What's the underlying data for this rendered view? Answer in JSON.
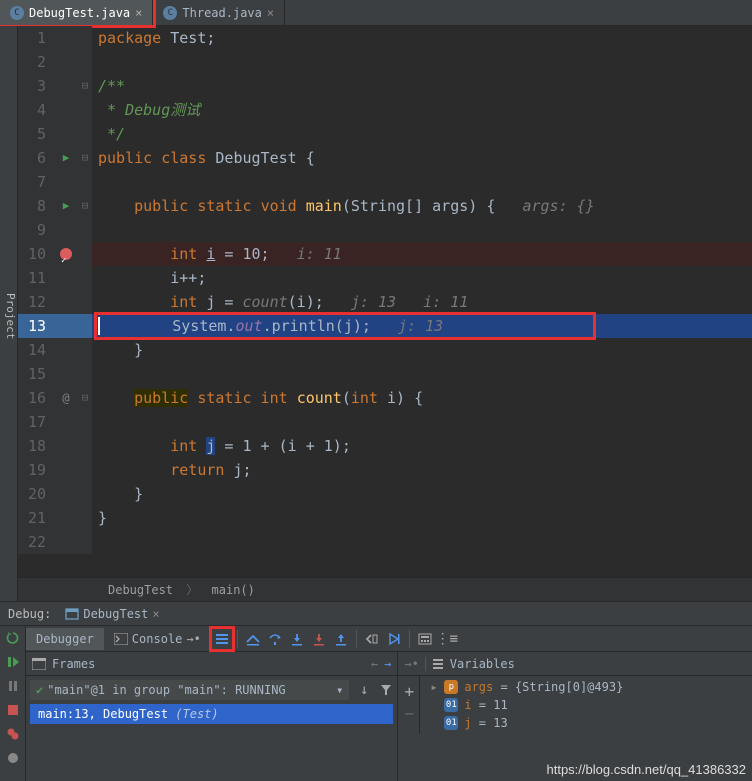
{
  "tabs": [
    {
      "label": "DebugTest.java",
      "active": true
    },
    {
      "label": "Thread.java",
      "active": false
    }
  ],
  "projectStrip": "Project",
  "code": {
    "lines": [
      {
        "n": 1,
        "html": "<span class='kw'>package</span> Test;"
      },
      {
        "n": 2,
        "html": ""
      },
      {
        "n": 3,
        "html": "<span class='doc'>/**</span>",
        "fold": "⊟"
      },
      {
        "n": 4,
        "html": "<span class='doc'> * Debug测试</span>"
      },
      {
        "n": 5,
        "html": "<span class='doc'> */</span>"
      },
      {
        "n": 6,
        "html": "<span class='kw'>public class</span> DebugTest {",
        "fold": "⊟",
        "icon": "play"
      },
      {
        "n": 7,
        "html": ""
      },
      {
        "n": 8,
        "html": "    <span class='kw'>public static</span> <span class='kw'>void</span> <span class='method'>main</span>(String[] args) {   <span class='hint'>args: {}</span>",
        "fold": "⊟",
        "icon": "play"
      },
      {
        "n": 9,
        "html": ""
      },
      {
        "n": 10,
        "html": "        <span class='kw'>int</span> <u>i</u> = 10;   <span class='hint'>i: 11</span>",
        "icon": "bp",
        "hl": "bp"
      },
      {
        "n": 11,
        "html": "        i++;"
      },
      {
        "n": 12,
        "html": "        <span class='kw'>int</span> j = <span class='hint'>count</span>(i);   <span class='hint'>j: 13   i: 11</span>"
      },
      {
        "n": 13,
        "html": "<span class='cursor'></span>        System.<span class='field'>out</span>.println(j);   <span class='hint'>j: 13</span>",
        "hl": "exec",
        "redbox": true
      },
      {
        "n": 14,
        "html": "    }"
      },
      {
        "n": 15,
        "html": ""
      },
      {
        "n": 16,
        "html": "    <span class='hl-kw'><span class='kw'>public</span></span> <span class='kw'>static int</span> <span class='method'>count</span>(<span class='kw'>int</span> i) {",
        "fold": "⊟",
        "icon": "at"
      },
      {
        "n": 17,
        "html": ""
      },
      {
        "n": 18,
        "html": "        <span class='kw'>int</span> <span style='background:#214283'>j</span> = 1 + (i + 1);"
      },
      {
        "n": 19,
        "html": "        <span class='kw'>return</span> j;"
      },
      {
        "n": 20,
        "html": "    }"
      },
      {
        "n": 21,
        "html": "}"
      },
      {
        "n": 22,
        "html": ""
      }
    ]
  },
  "breadcrumb": {
    "class": "DebugTest",
    "method": "main()"
  },
  "debug": {
    "label": "Debug:",
    "session": "DebugTest",
    "tabs": {
      "debugger": "Debugger",
      "console": "Console"
    },
    "frames": {
      "title": "Frames",
      "selected": "\"main\"@1 in group \"main\": RUNNING",
      "stack": {
        "loc": "main:13, DebugTest",
        "pkg": "(Test)"
      }
    },
    "variables": {
      "title": "Variables",
      "items": [
        {
          "badge": "p",
          "name": "args",
          "val": " = {String[0]@493}"
        },
        {
          "badge": "01",
          "name": "i",
          "val": " = 11"
        },
        {
          "badge": "01",
          "name": "j",
          "val": " = 13"
        }
      ]
    }
  },
  "watermark": "https://blog.csdn.net/qq_41386332"
}
